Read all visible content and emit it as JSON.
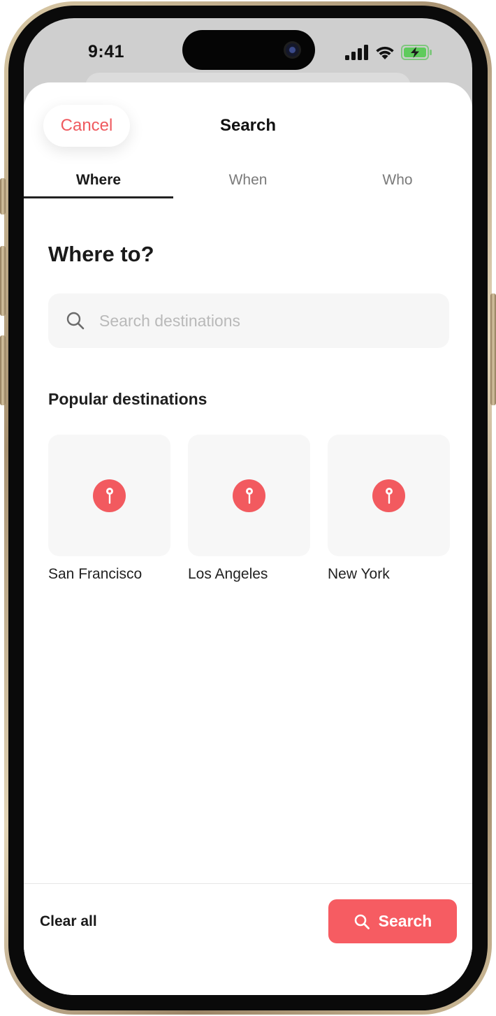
{
  "status_bar": {
    "time": "9:41"
  },
  "sheet": {
    "cancel_label": "Cancel",
    "title": "Search",
    "tabs": [
      {
        "label": "Where",
        "active": true
      },
      {
        "label": "When",
        "active": false
      },
      {
        "label": "Who",
        "active": false
      }
    ],
    "heading": "Where to?",
    "search": {
      "placeholder": "Search destinations",
      "value": ""
    },
    "popular_title": "Popular destinations",
    "destinations": [
      {
        "name": "San Francisco",
        "icon": "map-pin-icon"
      },
      {
        "name": "Los Angeles",
        "icon": "map-pin-icon"
      },
      {
        "name": "New York",
        "icon": "map-pin-icon"
      }
    ]
  },
  "footer": {
    "clear_label": "Clear all",
    "search_label": "Search"
  },
  "colors": {
    "accent": "#f65c62",
    "cancel_text": "#ef5a5f",
    "tile_bg": "#f7f7f7",
    "search_bg": "#f6f6f6"
  }
}
